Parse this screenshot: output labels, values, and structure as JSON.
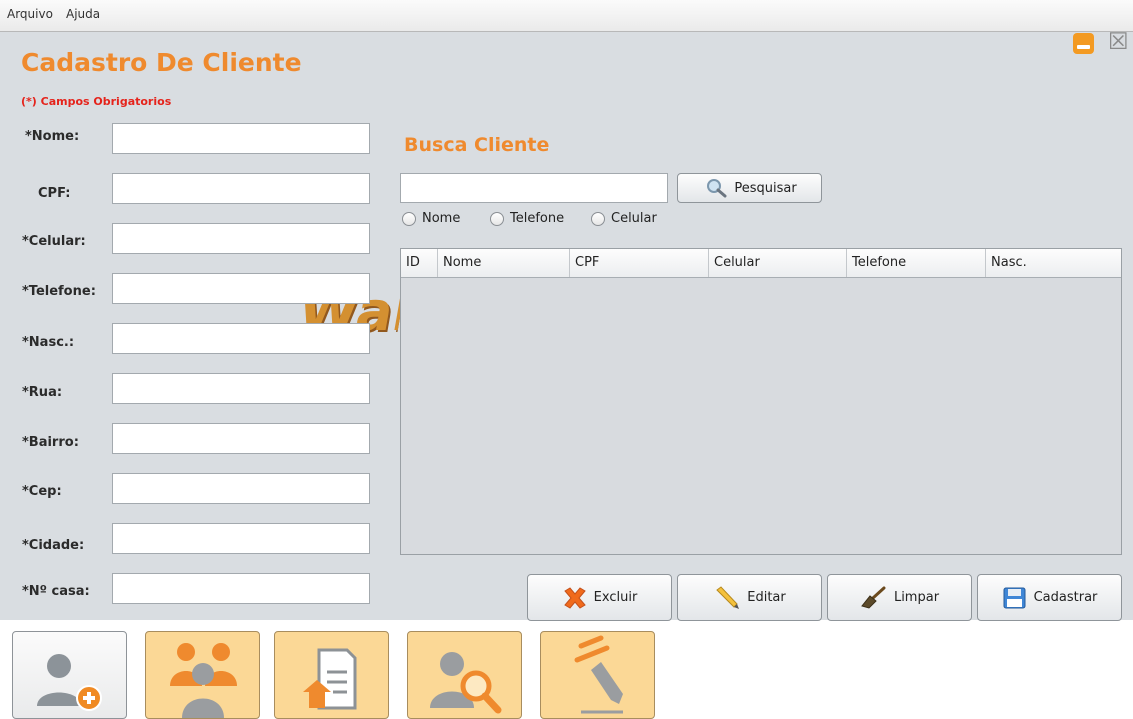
{
  "menu": {
    "items": [
      "Arquivo",
      "Ajuda"
    ]
  },
  "window": {
    "minimize_icon": "minimize-icon",
    "close_glyph": "☒"
  },
  "form": {
    "title": "Cadastro De Cliente",
    "required_note": "(*) Campos Obrigatorios",
    "fields": [
      {
        "label": "*Nome:",
        "value": ""
      },
      {
        "label": "CPF:",
        "value": ""
      },
      {
        "label": "*Celular:",
        "value": ""
      },
      {
        "label": "*Telefone:",
        "value": ""
      },
      {
        "label": "*Nasc.:",
        "value": ""
      },
      {
        "label": "*Rua:",
        "value": ""
      },
      {
        "label": "*Bairro:",
        "value": ""
      },
      {
        "label": "*Cep:",
        "value": ""
      },
      {
        "label": "*Cidade:",
        "value": ""
      },
      {
        "label": "*Nº casa:",
        "value": ""
      }
    ]
  },
  "search": {
    "title": "Busca Cliente",
    "query": "",
    "button_label": "Pesquisar",
    "options": [
      "Nome",
      "Telefone",
      "Celular"
    ]
  },
  "table": {
    "columns": [
      "ID",
      "Nome",
      "CPF",
      "Celular",
      "Telefone",
      "Nasc."
    ],
    "rows": []
  },
  "actions": {
    "excluir": "Excluir",
    "editar": "Editar",
    "limpar": "Limpar",
    "cadastrar": "Cadastrar"
  },
  "watermark_text": "Wald",
  "colors": {
    "accent": "#ef8a2e",
    "required": "#e5231b",
    "tile": "#fbd896",
    "background": "#d9dde1"
  }
}
